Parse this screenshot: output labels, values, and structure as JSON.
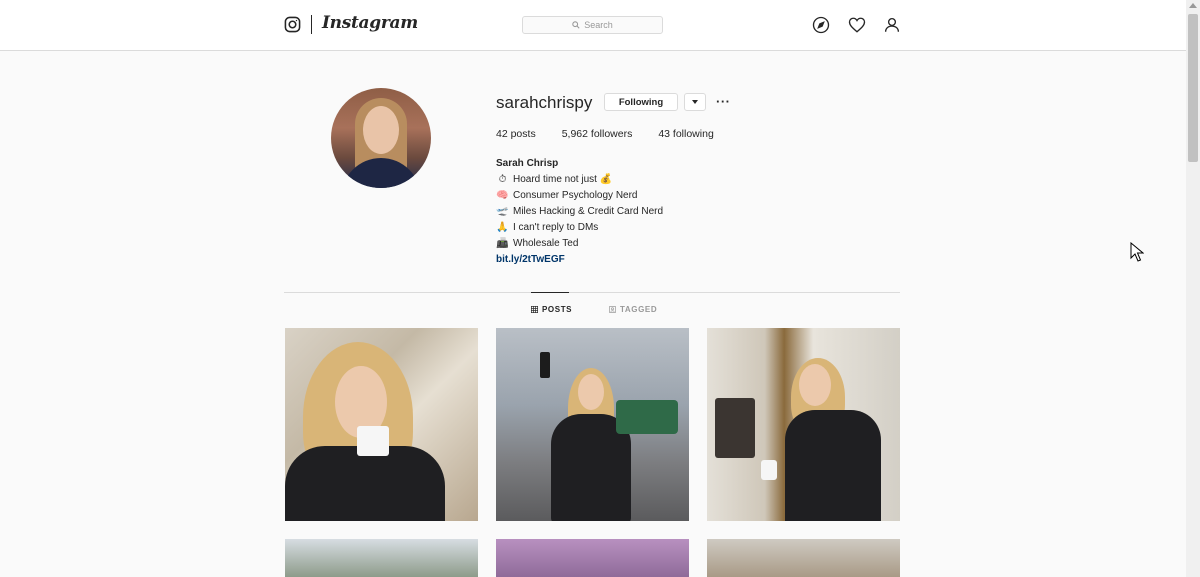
{
  "nav": {
    "wordmark": "Instagram",
    "search_placeholder": "Search"
  },
  "profile": {
    "username": "sarahchrispy",
    "following_label": "Following",
    "more_label": "···",
    "stats": {
      "posts": "42 posts",
      "followers": "5,962 followers",
      "following": "43 following"
    },
    "bio": {
      "name": "Sarah Chrisp",
      "lines": [
        {
          "emoji": "⏱",
          "text": "Hoard time not just 💰"
        },
        {
          "emoji": "🧠",
          "text": "Consumer Psychology Nerd"
        },
        {
          "emoji": "🛫",
          "text": "Miles Hacking & Credit Card Nerd"
        },
        {
          "emoji": "🙏",
          "text": "I can't reply to DMs"
        },
        {
          "emoji": "📠",
          "text": "Wholesale Ted"
        }
      ],
      "link": "bit.ly/2tTwEGF"
    }
  },
  "tabs": [
    {
      "label": "POSTS",
      "active": true,
      "icon": "grid-icon"
    },
    {
      "label": "TAGGED",
      "active": false,
      "icon": "tagged-icon"
    }
  ],
  "colors": {
    "link": "#003569",
    "border": "#dbdbdb",
    "text": "#262626",
    "muted": "#999999"
  }
}
